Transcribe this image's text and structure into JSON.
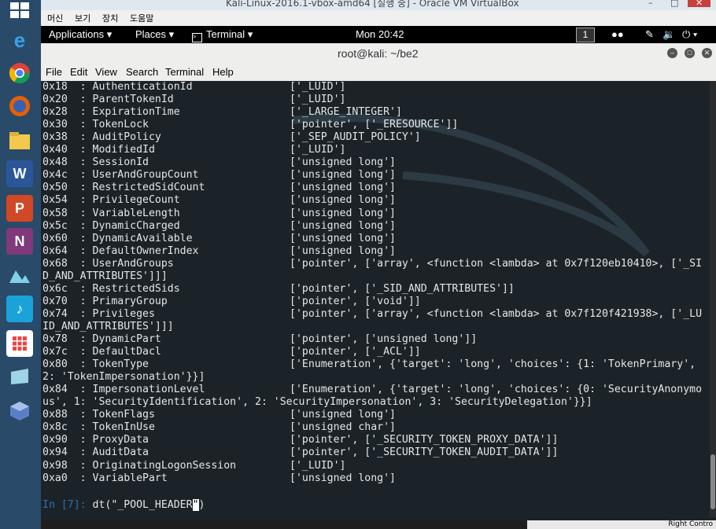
{
  "vbox": {
    "title": "Kali-Linux-2016.1-vbox-amd64 [실행 중] - Oracle VM VirtualBox",
    "menu": [
      "머신",
      "보기",
      "장치",
      "도움말"
    ]
  },
  "kali_bar": {
    "applications": "Applications ▾",
    "places": "Places ▾",
    "terminal": "Terminal ▾",
    "clock": "Mon 20:42",
    "workspace": "1"
  },
  "terminal": {
    "title": "root@kali: ~/be2",
    "menu": [
      "File",
      "Edit",
      "View",
      "Search",
      "Terminal",
      "Help"
    ],
    "lines": [
      {
        "a": "0x18  : AuthenticationId",
        "b": "['_LUID']"
      },
      {
        "a": "0x20  : ParentTokenId",
        "b": "['_LUID']"
      },
      {
        "a": "0x28  : ExpirationTime",
        "b": "['_LARGE_INTEGER']"
      },
      {
        "a": "0x30  : TokenLock",
        "b": "['pointer', ['_ERESOURCE']]"
      },
      {
        "a": "0x38  : AuditPolicy",
        "b": "['_SEP_AUDIT_POLICY']"
      },
      {
        "a": "0x40  : ModifiedId",
        "b": "['_LUID']"
      },
      {
        "a": "0x48  : SessionId",
        "b": "['unsigned long']"
      },
      {
        "a": "0x4c  : UserAndGroupCount",
        "b": "['unsigned long']"
      },
      {
        "a": "0x50  : RestrictedSidCount",
        "b": "['unsigned long']"
      },
      {
        "a": "0x54  : PrivilegeCount",
        "b": "['unsigned long']"
      },
      {
        "a": "0x58  : VariableLength",
        "b": "['unsigned long']"
      },
      {
        "a": "0x5c  : DynamicCharged",
        "b": "['unsigned long']"
      },
      {
        "a": "0x60  : DynamicAvailable",
        "b": "['unsigned long']"
      },
      {
        "a": "0x64  : DefaultOwnerIndex",
        "b": "['unsigned long']"
      },
      {
        "a": "0x68  : UserAndGroups",
        "b": "['pointer', ['array', <function <lambda> at 0x7f120eb10410>, ['_SI"
      },
      {
        "a": "D_AND_ATTRIBUTES']]]",
        "b": ""
      },
      {
        "a": "0x6c  : RestrictedSids",
        "b": "['pointer', ['_SID_AND_ATTRIBUTES']]"
      },
      {
        "a": "0x70  : PrimaryGroup",
        "b": "['pointer', ['void']]"
      },
      {
        "a": "0x74  : Privileges",
        "b": "['pointer', ['array', <function <lambda> at 0x7f120f421938>, ['_LU"
      },
      {
        "a": "ID_AND_ATTRIBUTES']]]",
        "b": ""
      },
      {
        "a": "0x78  : DynamicPart",
        "b": "['pointer', ['unsigned long']]"
      },
      {
        "a": "0x7c  : DefaultDacl",
        "b": "['pointer', ['_ACL']]"
      },
      {
        "a": "0x80  : TokenType",
        "b": "['Enumeration', {'target': 'long', 'choices': {1: 'TokenPrimary',"
      },
      {
        "a": "2: 'TokenImpersonation'}}]",
        "b": ""
      },
      {
        "a": "0x84  : ImpersonationLevel",
        "b": "['Enumeration', {'target': 'long', 'choices': {0: 'SecurityAnonymo"
      },
      {
        "a": "us', 1: 'SecurityIdentification', 2: 'SecurityImpersonation', 3: 'SecurityDelegation'}}]",
        "b": ""
      },
      {
        "a": "0x88  : TokenFlags",
        "b": "['unsigned long']"
      },
      {
        "a": "0x8c  : TokenInUse",
        "b": "['unsigned char']"
      },
      {
        "a": "0x90  : ProxyData",
        "b": "['pointer', ['_SECURITY_TOKEN_PROXY_DATA']]"
      },
      {
        "a": "0x94  : AuditData",
        "b": "['pointer', ['_SECURITY_TOKEN_AUDIT_DATA']]"
      },
      {
        "a": "0x98  : OriginatingLogonSession",
        "b": "['_LUID']"
      },
      {
        "a": "0xa0  : VariablePart",
        "b": "['unsigned long']"
      }
    ],
    "prompt": "In [7]:",
    "command_before": " dt(\"_POOL_HEADER",
    "cursor_char": "\"",
    "command_after": ")"
  },
  "host_tray": {
    "label": "Right Contro"
  },
  "colors": {
    "terminal_bg": "#1b2329",
    "prompt": "#2e6fa8",
    "taskbar": "#2a4a6a"
  },
  "taskbar_icons": [
    "windows-start-icon",
    "ie-icon",
    "chrome-icon",
    "firefox-icon",
    "explorer-icon",
    "word-icon",
    "powerpoint-icon",
    "onenote-icon",
    "photos-icon",
    "app-icon",
    "apps-grid-icon",
    "notes-icon",
    "virtualbox-icon"
  ]
}
